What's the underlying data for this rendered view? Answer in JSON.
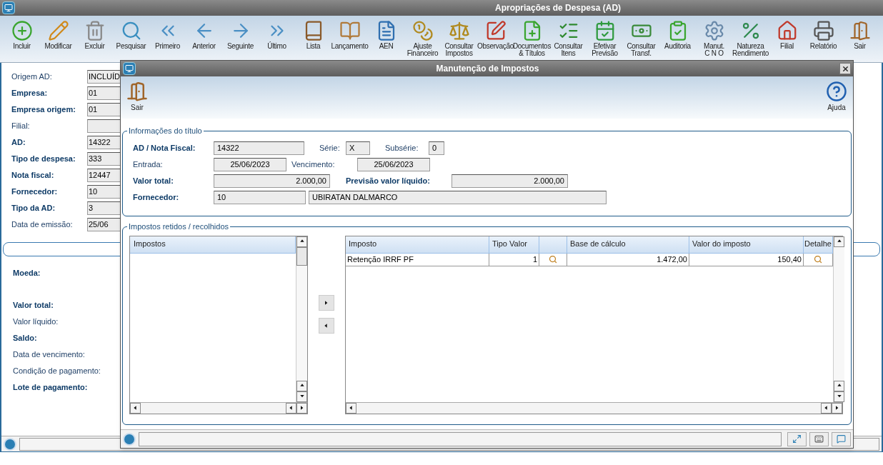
{
  "window": {
    "title": "Apropriações de Despesa (AD)"
  },
  "toolbar": [
    {
      "label": "Incluir"
    },
    {
      "label": "Modificar"
    },
    {
      "label": "Excluir"
    },
    {
      "label": "Pesquisar"
    },
    {
      "label": "Primeiro"
    },
    {
      "label": "Anterior"
    },
    {
      "label": "Seguinte"
    },
    {
      "label": "Último"
    },
    {
      "label": "Lista"
    },
    {
      "label": "Lançamento"
    },
    {
      "label": "AEN"
    },
    {
      "label": "Ajuste\nFinanceiro"
    },
    {
      "label": "Consultar\nImpostos"
    },
    {
      "label": "Observação"
    },
    {
      "label": "Documentos\n& Títulos"
    },
    {
      "label": "Consultar\nItens"
    },
    {
      "label": "Efetivar\nPrevisão"
    },
    {
      "label": "Consultar\nTransf."
    },
    {
      "label": "Auditoria"
    },
    {
      "label": "Manut.\nC N O"
    },
    {
      "label": "Natureza\nRendimento"
    },
    {
      "label": "Filial"
    },
    {
      "label": "Relatório"
    },
    {
      "label": "Sair"
    }
  ],
  "form": {
    "fields": [
      {
        "label": "Origem AD:",
        "bold": false,
        "value": "INCLUÍD"
      },
      {
        "label": "Empresa:",
        "bold": true,
        "value": "01"
      },
      {
        "label": "Empresa origem:",
        "bold": true,
        "value": "01"
      },
      {
        "label": "Filial:",
        "bold": false
      },
      {
        "label": "AD:",
        "bold": true,
        "value": "14322"
      },
      {
        "label": "Tipo de despesa:",
        "bold": true,
        "value": "333"
      },
      {
        "label": "Nota fiscal:",
        "bold": true,
        "value": "12447"
      },
      {
        "label": "Fornecedor:",
        "bold": true,
        "value": "10"
      },
      {
        "label": "Tipo da AD:",
        "bold": true,
        "value": "3"
      },
      {
        "label": "Data de emissão:",
        "bold": false,
        "value": "25/06"
      }
    ],
    "summary": [
      {
        "label": "Moeda:",
        "bold": true
      },
      {
        "label": "Valor total:",
        "bold": true
      },
      {
        "label": "Valor líquido:",
        "bold": false
      },
      {
        "label": "Saldo:",
        "bold": true
      },
      {
        "label": "Data de vencimento:",
        "bold": false
      },
      {
        "label": "Condição de pagamento:",
        "bold": false
      },
      {
        "label": "Lote de pagamento:",
        "bold": true
      }
    ]
  },
  "dialog": {
    "title": "Manutenção de Impostos",
    "toolbar": [
      {
        "label": "Sair"
      },
      {
        "label": "Ajuda"
      }
    ],
    "info": {
      "legend": "Informações do título",
      "ad_label": "AD / Nota Fiscal:",
      "ad": "14322",
      "serie_label": "Série:",
      "serie": "X",
      "subserie_label": "Subsérie:",
      "subserie": "0",
      "entrada_label": "Entrada:",
      "entrada": "25/06/2023",
      "vencimento_label": "Vencimento:",
      "vencimento": "25/06/2023",
      "total_label": "Valor total:",
      "total": "2.000,00",
      "liquido_label": "Previsão valor líquido:",
      "liquido": "2.000,00",
      "fornecedor_label": "Fornecedor:",
      "fornecedor_code": "10",
      "fornecedor_name": "UBIRATAN DALMARCO"
    },
    "taxes": {
      "legend": "Impostos retidos / recolhidos",
      "available_header": "Impostos",
      "columns": [
        {
          "kind": "text",
          "label": "Imposto"
        },
        {
          "kind": "text",
          "label": "Tipo Valor"
        },
        {
          "kind": "icon"
        },
        {
          "kind": "text",
          "label": "Base de cálculo"
        },
        {
          "kind": "text",
          "label": "Valor do imposto"
        },
        {
          "kind": "text",
          "label": "Detalhe"
        }
      ],
      "rows": [
        {
          "imposto": "Retenção IRRF PF",
          "tipo_valor": "1",
          "base": "1.472,00",
          "valor": "150,40"
        }
      ]
    }
  }
}
